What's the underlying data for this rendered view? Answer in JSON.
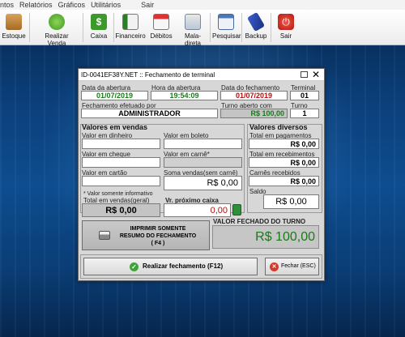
{
  "menu": {
    "items": [
      "ntos",
      "Relatórios",
      "Gráficos",
      "Utilitários"
    ],
    "sair": "Sair"
  },
  "toolbar": {
    "buttons": [
      {
        "label": "Estoque",
        "icon": "boxes-icon"
      },
      {
        "label": "Realizar Venda",
        "icon": "shopping-cart-icon"
      },
      {
        "label": "Caixa",
        "icon": "dollar-icon"
      },
      {
        "label": "Financeiro",
        "icon": "spreadsheet-icon"
      },
      {
        "label": "Débitos",
        "icon": "calendar-icon"
      },
      {
        "label": "Mala-direta",
        "icon": "mail-icon"
      },
      {
        "label": "Pesquisar",
        "icon": "search-window-icon"
      },
      {
        "label": "Backup",
        "icon": "usb-drive-icon"
      },
      {
        "label": "Sair",
        "icon": "power-icon"
      }
    ]
  },
  "dialog": {
    "title": "ID-0041EF38Y.NET :: Fechamento de terminal",
    "data_abertura_label": "Data da abertura",
    "data_abertura": "01/07/2019",
    "hora_abertura_label": "Hora da abertura",
    "hora_abertura": "19:54:09",
    "data_fechamento_label": "Data do fechamento",
    "data_fechamento": "01/07/2019",
    "terminal_label": "Terminal",
    "terminal": "01",
    "efetuado_por_label": "Fechamento efetuado por",
    "efetuado_por": "ADMINISTRADOR",
    "turno_aberto_label": "Turno aberto com",
    "turno_aberto": "R$ 100,00",
    "turno_label": "Turno",
    "turno": "1",
    "vendas": {
      "title": "Valores em vendas",
      "dinheiro": "Valor em dinheiro",
      "boleto": "Valor em boleto",
      "cheque": "Valor em cheque",
      "carne": "Valor em carnê*",
      "cartao": "Valor em cartão",
      "soma_label": "Soma vendas(sem carnê)",
      "soma": "R$ 0,00",
      "informativo": "* Valor somente informativo",
      "total_geral_label": "Total em vendas(geral)",
      "total_geral": "R$ 0,00",
      "proximo_caixa_label": "Vr. próximo caixa",
      "proximo_caixa": "0,00"
    },
    "diversos": {
      "title": "Valores diversos",
      "pagamentos_label": "Total em pagamentos",
      "pagamentos": "R$ 0,00",
      "recebimentos_label": "Total em recebimentos",
      "recebimentos": "R$ 0,00",
      "carnes_label": "Carnês recebidos",
      "carnes": "R$ 0,00",
      "saldo_label": "Saldo",
      "saldo": "R$ 0,00"
    },
    "imprimir_line1": "IMPRIMIR SOMENTE",
    "imprimir_line2": "RESUMO DO FECHAMENTO",
    "imprimir_line3": "( F4 )",
    "valor_fechado_label": "VALOR FECHADO DO TURNO",
    "valor_fechado": "R$ 100,00",
    "realizar_label": "Realizar fechamento (F12)",
    "fechar_label": "Fechar (ESC)"
  }
}
